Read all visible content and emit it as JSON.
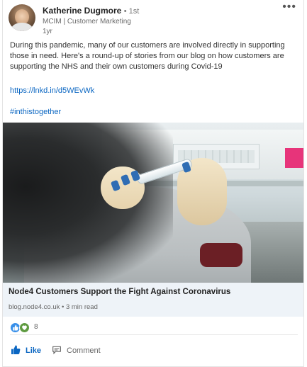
{
  "author": {
    "name": "Katherine Dugmore",
    "degree": "• 1st",
    "headline": "MCIM | Customer Marketing",
    "time": "1yr"
  },
  "post": {
    "text": "During this pandemic, many of our customers are involved directly in supporting those in need. Here's a round-up of stories from our blog on how customers are supporting the NHS and their own customers during Covid-19",
    "link": "https://lnkd.in/d5WEvWk",
    "hashtag": "#inthistogether"
  },
  "preview": {
    "title": "Node4 Customers Support the Fight Against Coronavirus",
    "subtitle": "blog.node4.co.uk • 3 min read"
  },
  "social": {
    "reaction_count": "8"
  },
  "actions": {
    "like": "Like",
    "comment": "Comment"
  },
  "colors": {
    "link": "#0a66c2",
    "preview_bg": "#eef3f8"
  }
}
